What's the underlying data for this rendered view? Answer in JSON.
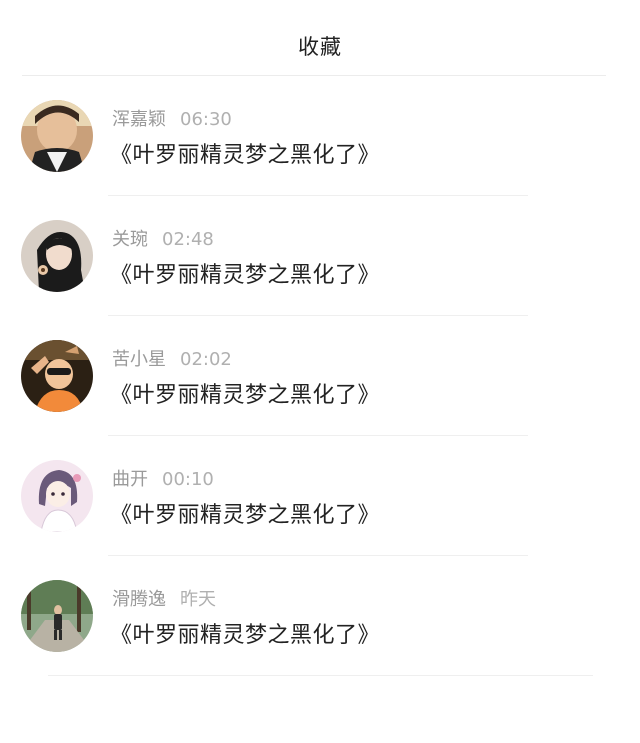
{
  "header": {
    "title": "收藏"
  },
  "favorites": [
    {
      "user": "浑嘉颖",
      "time": "06:30",
      "title": "《叶罗丽精灵梦之黑化了》"
    },
    {
      "user": "关琬",
      "time": "02:48",
      "title": "《叶罗丽精灵梦之黑化了》"
    },
    {
      "user": "苦小星",
      "time": "02:02",
      "title": "《叶罗丽精灵梦之黑化了》"
    },
    {
      "user": "曲开",
      "time": "00:10",
      "title": "《叶罗丽精灵梦之黑化了》"
    },
    {
      "user": "滑腾逸",
      "time": "昨天",
      "title": "《叶罗丽精灵梦之黑化了》"
    }
  ],
  "colors": {
    "background": "#ffffff",
    "title_text": "#222222",
    "meta_text": "#9a9a9a",
    "divider": "#ececec"
  }
}
